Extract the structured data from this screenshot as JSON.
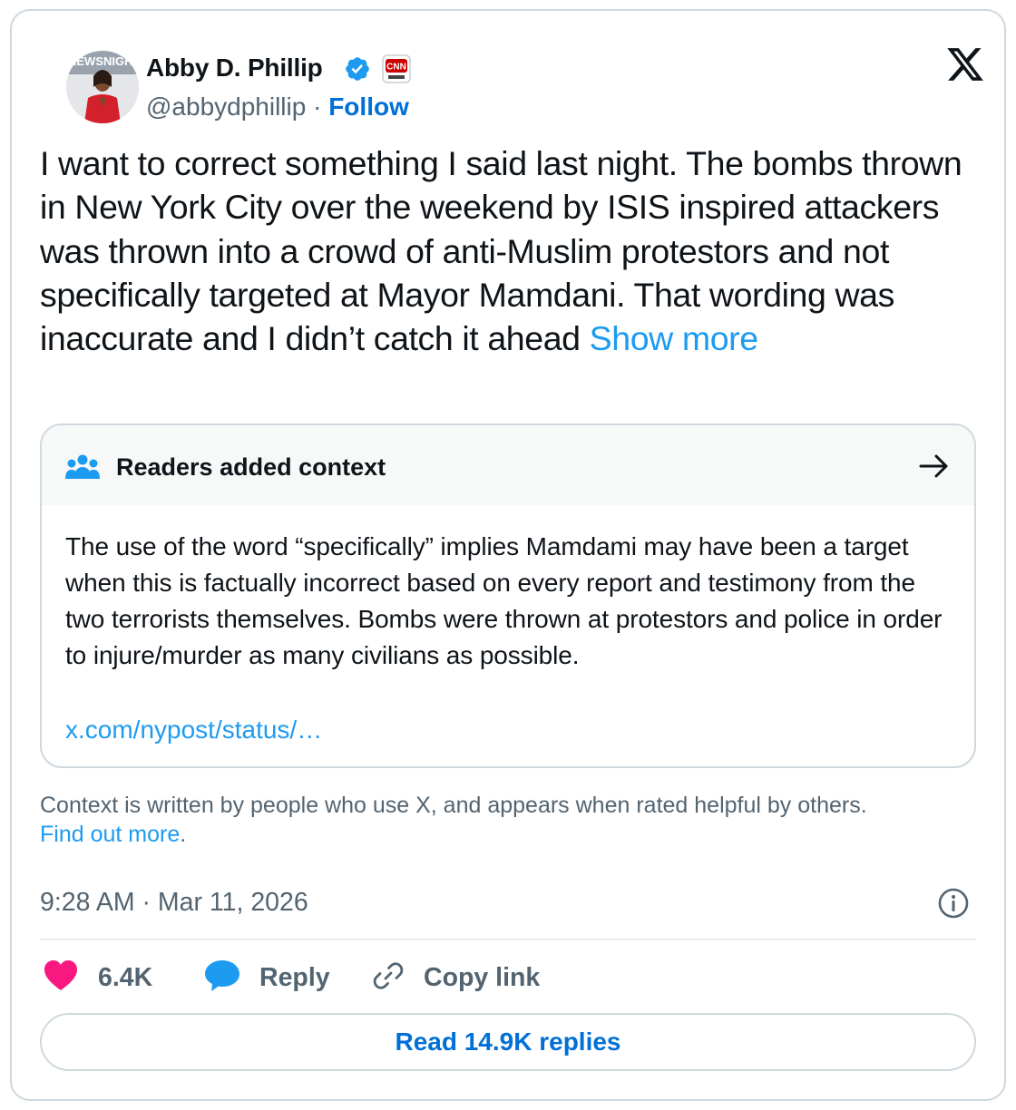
{
  "author": {
    "name": "Abby D. Phillip",
    "handle": "@abbydphillip",
    "separator": "·",
    "follow_label": "Follow",
    "avatar_overlay_text": "NEWSNIGHT",
    "affiliation_badge": "CNN",
    "verified": true
  },
  "tweet": {
    "text": "I want to correct something I said last night. The bombs thrown in New York City over the weekend by ISIS inspired attackers was thrown into a crowd of anti-Muslim protestors and not specifically targeted at Mayor Mamdani. That wording was inaccurate and I didn’t catch it ahead",
    "show_more_label": "Show more"
  },
  "community_note": {
    "title": "Readers added context",
    "body": "The use of the word “specifically” implies Mamdami may have been a target when this is factually incorrect based on every report and testimony from the two terrorists themselves. Bombs were thrown at protestors and police in order to injure/murder as many civilians as possible.",
    "link_text": "x.com/nypost/status/…"
  },
  "context_footer": {
    "text": "Context is written by people who use X, and appears when rated helpful by others.",
    "link_label": "Find out more",
    "link_suffix": "."
  },
  "timestamp": "9:28 AM · Mar 11, 2026",
  "actions": {
    "like_count": "6.4K",
    "reply_label": "Reply",
    "copy_link_label": "Copy link"
  },
  "read_replies_label": "Read 14.9K replies",
  "colors": {
    "link": "#1d9bf0",
    "follow": "#006fd6",
    "like": "#f91880",
    "secondary_text": "#536471",
    "border": "#cfd9de"
  },
  "icons": [
    "verified-badge-icon",
    "cnn-affiliate-icon",
    "x-logo-icon",
    "people-icon",
    "arrow-right-icon",
    "info-icon",
    "heart-icon",
    "reply-bubble-icon",
    "link-icon"
  ]
}
